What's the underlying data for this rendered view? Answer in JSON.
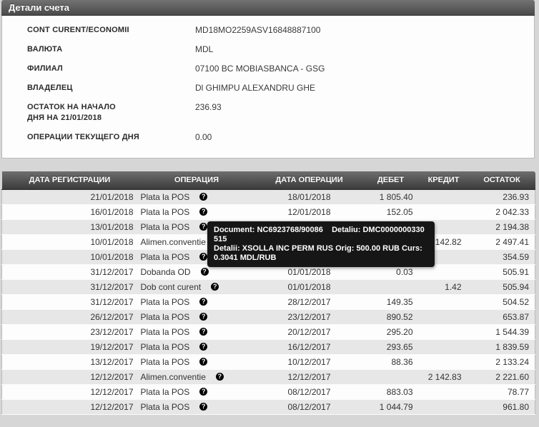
{
  "title": "Детали счета",
  "account_info": {
    "rows": [
      {
        "label": "CONT CURENT/ECONOMII",
        "label2": "",
        "value": "MD18MO2259ASV16848887100"
      },
      {
        "label": "ВАЛЮТА",
        "label2": "",
        "value": "MDL"
      },
      {
        "label": "ФИЛИАЛ",
        "label2": "",
        "value": "07100 BC MOBIASBANCA - GSG"
      },
      {
        "label": "ВЛАДЕЛЕЦ",
        "label2": "",
        "value": "Dl GHIMPU ALEXANDRU GHE"
      },
      {
        "label": "ОСТАТОК НА НАЧАЛО",
        "label2": "ДНЯ НА 21/01/2018",
        "value": "236.93"
      },
      {
        "label": "ОПЕРАЦИИ ТЕКУЩЕГО ДНЯ",
        "label2": "",
        "value": "0.00"
      }
    ]
  },
  "transactions": {
    "columns": [
      "ДАТА РЕГИСТРАЦИИ",
      "ОПЕРАЦИЯ",
      "ДАТА ОПЕРАЦИИ",
      "ДЕБЕТ",
      "КРЕДИТ",
      "ОСТАТОК"
    ],
    "help_icon": "?",
    "rows": [
      {
        "reg_date": "21/01/2018",
        "operation": "Plata la POS",
        "op_date": "18/01/2018",
        "debit": "1 805.40",
        "credit": "",
        "balance": "236.93"
      },
      {
        "reg_date": "16/01/2018",
        "operation": "Plata la POS",
        "op_date": "12/01/2018",
        "debit": "152.05",
        "credit": "",
        "balance": "2 042.33"
      },
      {
        "reg_date": "13/01/2018",
        "operation": "Plata la POS",
        "op_date": "",
        "debit": "",
        "credit": "",
        "balance": "2 194.38"
      },
      {
        "reg_date": "10/01/2018",
        "operation": "Alimen.conventie",
        "op_date": "",
        "debit": "",
        "credit": "2 142.82",
        "balance": "2 497.41"
      },
      {
        "reg_date": "10/01/2018",
        "operation": "Plata la POS",
        "op_date": "",
        "debit": "",
        "credit": "",
        "balance": "354.59"
      },
      {
        "reg_date": "31/12/2017",
        "operation": "Dobanda OD",
        "op_date": "01/01/2018",
        "debit": "0.03",
        "credit": "",
        "balance": "505.91"
      },
      {
        "reg_date": "31/12/2017",
        "operation": "Dob cont curent",
        "op_date": "01/01/2018",
        "debit": "",
        "credit": "1.42",
        "balance": "505.94"
      },
      {
        "reg_date": "31/12/2017",
        "operation": "Plata la POS",
        "op_date": "28/12/2017",
        "debit": "149.35",
        "credit": "",
        "balance": "504.52"
      },
      {
        "reg_date": "26/12/2017",
        "operation": "Plata la POS",
        "op_date": "23/12/2017",
        "debit": "890.52",
        "credit": "",
        "balance": "653.87"
      },
      {
        "reg_date": "23/12/2017",
        "operation": "Plata la POS",
        "op_date": "20/12/2017",
        "debit": "295.20",
        "credit": "",
        "balance": "1 544.39"
      },
      {
        "reg_date": "19/12/2017",
        "operation": "Plata la POS",
        "op_date": "16/12/2017",
        "debit": "293.65",
        "credit": "",
        "balance": "1 839.59"
      },
      {
        "reg_date": "13/12/2017",
        "operation": "Plata la POS",
        "op_date": "10/12/2017",
        "debit": "88.36",
        "credit": "",
        "balance": "2 133.24"
      },
      {
        "reg_date": "12/12/2017",
        "operation": "Alimen.conventie",
        "op_date": "12/12/2017",
        "debit": "",
        "credit": "2 142.83",
        "balance": "2 221.60"
      },
      {
        "reg_date": "12/12/2017",
        "operation": "Plata la POS",
        "op_date": "08/12/2017",
        "debit": "883.03",
        "credit": "",
        "balance": "78.77"
      },
      {
        "reg_date": "12/12/2017",
        "operation": "Plata la POS",
        "op_date": "08/12/2017",
        "debit": "1 044.79",
        "credit": "",
        "balance": "961.80"
      }
    ]
  },
  "tooltip": {
    "line1": "Document: NC6923768/90086    Detaliu: DMC0000000330515",
    "line2": "Detalii: XSOLLA INC PERM RUS Orig: 500.00 RUB Curs: 0.3041 MDL/RUB"
  },
  "colors": {
    "header_bar_top": "#6e6e6e",
    "header_bar_bottom": "#3b3b3b",
    "row_alt": "#e7e7e7",
    "row_base": "#fdfdfd",
    "page_background": "#d6d6d6",
    "tooltip_background": "#161616",
    "text": "#333333"
  }
}
